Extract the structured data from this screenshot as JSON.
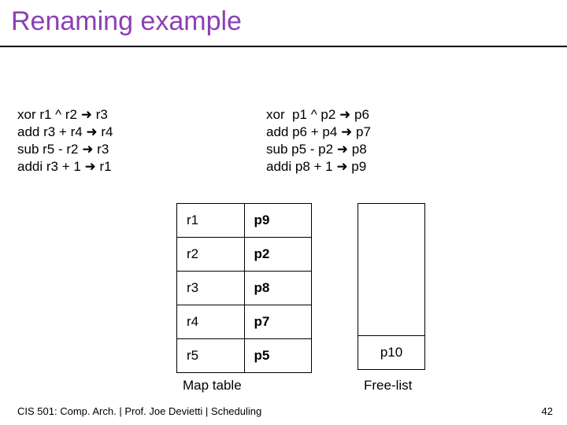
{
  "title": "Renaming example",
  "code_left": {
    "l1a": "xor r1 ^ r2 ",
    "l1b": " r3",
    "l2a": "add r3 + r4 ",
    "l2b": " r4",
    "l3a": "sub r5 - r2 ",
    "l3b": " r3",
    "l4a": "addi r3 + 1 ",
    "l4b": " r1"
  },
  "code_right": {
    "l1a": "xor  p1 ^ p2 ",
    "l1b": " p6",
    "l2a": "add p6 + p4 ",
    "l2b": " p7",
    "l3a": "sub p5 - p2 ",
    "l3b": " p8",
    "l4a": "addi p8 + 1 ",
    "l4b": " p9"
  },
  "map_table": [
    {
      "arch": "r1",
      "phys": "p9"
    },
    {
      "arch": "r2",
      "phys": "p2"
    },
    {
      "arch": "r3",
      "phys": "p8"
    },
    {
      "arch": "r4",
      "phys": "p7"
    },
    {
      "arch": "r5",
      "phys": "p5"
    }
  ],
  "map_caption": "Map table",
  "free_list_entry": "p10",
  "free_caption": "Free-list",
  "footer": "CIS 501: Comp. Arch.  |  Prof. Joe Devietti  |  Scheduling",
  "page": "42",
  "arrow": "➜"
}
